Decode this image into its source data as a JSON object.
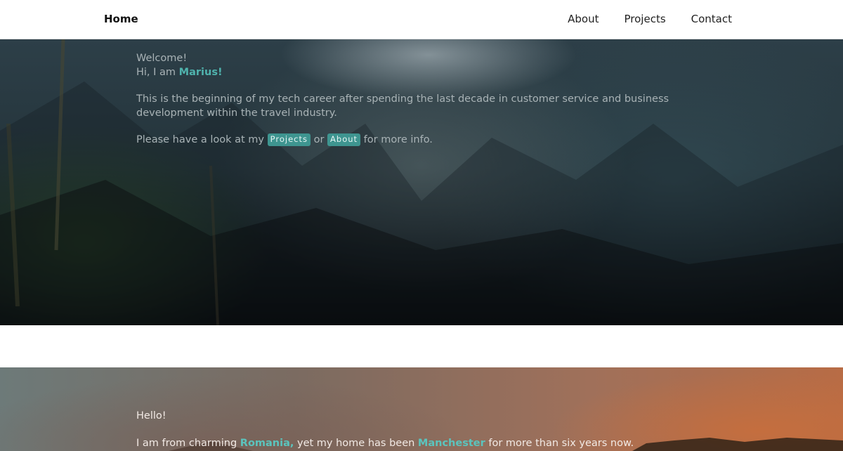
{
  "nav": {
    "brand": "Home",
    "links": [
      "About",
      "Projects",
      "Contact"
    ]
  },
  "hero": {
    "welcome": "Welcome!",
    "greeting_prefix": "Hi, I am ",
    "name": "Marius!",
    "intro": "This is the beginning of my tech career after spending the last decade in customer service and business development within the travel industry.",
    "cta_prefix": "Please have a look at my ",
    "projects_pill": "Projects",
    "cta_or": " or ",
    "about_pill": "About",
    "cta_suffix": " for more info."
  },
  "about": {
    "hello": "Hello!",
    "from_prefix": "I am from charming ",
    "country": "Romania,",
    "home_middle": " yet my home has been ",
    "city": "Manchester",
    "home_suffix": " for more than six years now."
  },
  "colors": {
    "accent": "#4fb3ad",
    "pill": "#3e9590"
  }
}
